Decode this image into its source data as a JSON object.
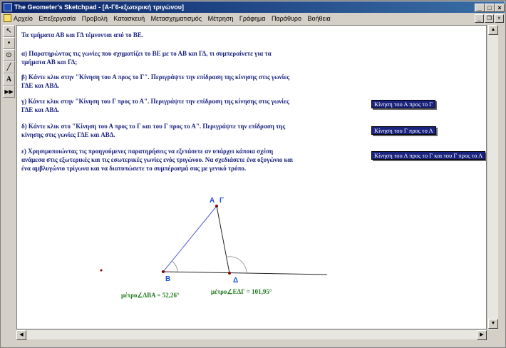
{
  "window": {
    "title": "The Geometer's Sketchpad - [Α-Γ6-εξωτερική τριγώνου]",
    "min_label": "_",
    "max_label": "□",
    "close_label": "×"
  },
  "menubar": {
    "items": [
      "Αρχείο",
      "Επεξεργασία",
      "Προβολή",
      "Κατασκευή",
      "Μετασχηματισμός",
      "Μέτρηση",
      "Γράφημα",
      "Παράθυρο",
      "Βοήθεια"
    ]
  },
  "toolbox": {
    "tools": [
      {
        "name": "arrow-tool-icon",
        "glyph": "↖"
      },
      {
        "name": "point-tool-icon",
        "glyph": "•"
      },
      {
        "name": "compass-tool-icon",
        "glyph": "⊙"
      },
      {
        "name": "straightedge-tool-icon",
        "glyph": "╱"
      },
      {
        "name": "text-tool-icon",
        "glyph": "A"
      },
      {
        "name": "custom-tool-icon",
        "glyph": "▶▶"
      }
    ]
  },
  "content": {
    "intro": "Τα τμήματα ΑΒ και ΓΔ τέμνονται από το ΒΕ.",
    "qa_line1": "α) Παρατηρώντας τις γωνίες που σχηματίζει το ΒΕ με το ΑΒ και ΓΔ, τι συμπεραίνετε για τα",
    "qa_line2": "τμήματα ΑΒ και ΓΔ;",
    "qb_line1": "β) Κάντε κλικ στην \"Κίνηση του Α προς το Γ\". Περιγράψτε την επίδραση της κίνησης στις γωνίες",
    "qb_line2": "ΓΔΕ και ΑΒΔ.",
    "qc_line1": "γ) Κάντε κλικ στην \"Κίνηση του Γ προς το Α\". Περιγράψτε την επίδραση της κίνησης στις γωνίες",
    "qc_line2": "ΓΔΕ και ΑΒΔ.",
    "qd_line1": "δ) Κάντε κλικ στο \"Κίνηση του Α προς το Γ και του Γ προς το Α\". Περιγράψτε την επίδραση της",
    "qd_line2": "κίνησης στις γωνίες ΓΔΕ και ΑΒΔ.",
    "qe_line1": "ε) Χρησιμοποιώντας τις προηγούμενες παρατηρήσεις να εξετάσετε αν υπάρχει κάποια σχέση",
    "qe_line2": "ανάμεσα στις εξωτερικές και τις εσωτερικές γωνίες ενός τριγώνου. Να σχεδιάσετε ένα οξυγώνιο και",
    "qe_line3": "ένα αμβλυγώνιο τρίγωνα και να διατυπώσετε το συμπέρασμά σας με γενικό τρόπο."
  },
  "buttons": {
    "move_a_to_g": "Κίνηση του Α προς το Γ",
    "move_g_to_a": "Κίνηση του Γ προς το Α",
    "move_both": "Κίνηση του Α προς το Γ και του Γ προς το Α"
  },
  "figure": {
    "label_a": "Α",
    "label_g": "Γ",
    "label_b": "Β",
    "label_d": "Δ",
    "measure_dba": "μέτρο∠ΔΒΑ = 52,26°",
    "measure_edg": "μέτρο∠ΕΔΓ = 101,95°"
  },
  "colors": {
    "text": "#1a237e",
    "points": "#1a4fd0",
    "measure": "#1f7a1f",
    "point_dot": "#8b0000"
  }
}
